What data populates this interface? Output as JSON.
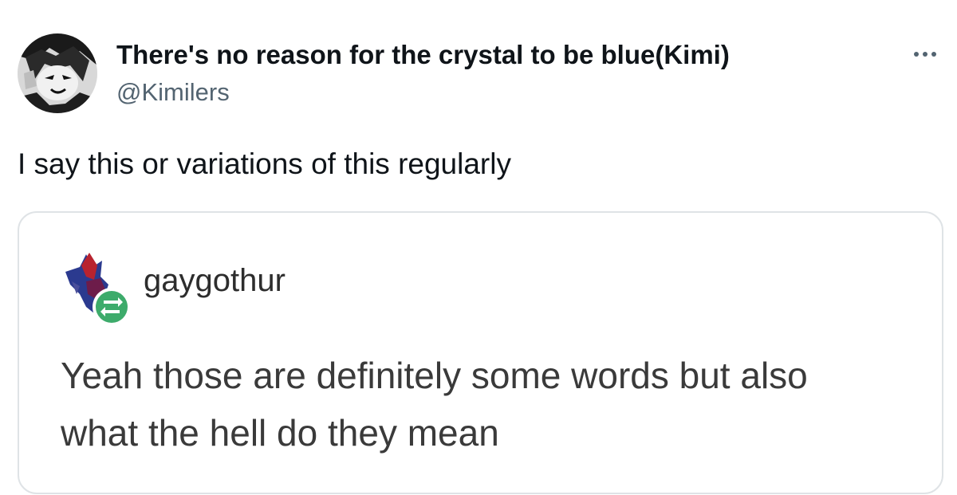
{
  "tweet": {
    "display_name": "There's no reason for the crystal to be blue(Kimi)",
    "handle": "@Kimilers",
    "text": "I say this or variations of this regularly"
  },
  "quoted": {
    "username": "gaygothur",
    "body_lines": [
      "Yeah those are definitely some words but also",
      "what the hell do they mean"
    ],
    "reblog_color": "#3dab6b"
  },
  "icons": {
    "more": "more-horizontal-icon",
    "reblog": "reblog-icon"
  },
  "colors": {
    "text_primary": "#0f1419",
    "text_secondary": "#536471",
    "card_border": "#dfe3e6"
  }
}
